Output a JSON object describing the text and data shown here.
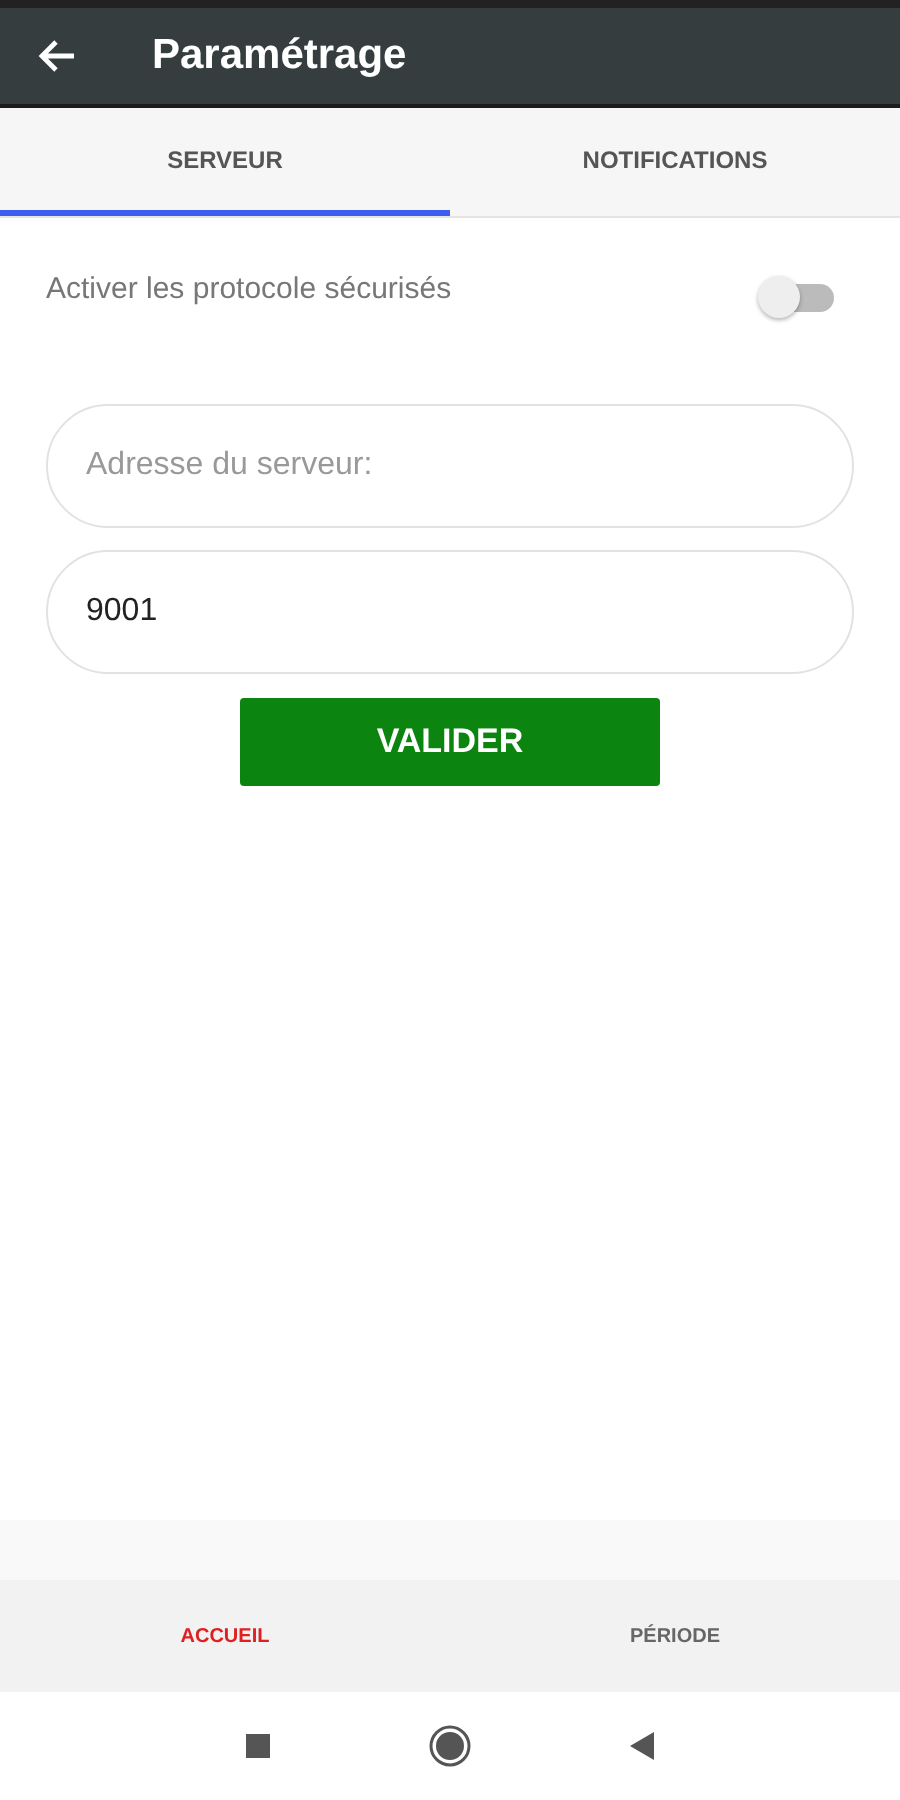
{
  "app_bar": {
    "title": "Paramétrage"
  },
  "tabs": [
    {
      "label": "SERVEUR",
      "selected": true
    },
    {
      "label": "NOTIFICATIONS",
      "selected": false
    }
  ],
  "secure_toggle": {
    "label": "Activer les protocole sécurisés",
    "on": false
  },
  "fields": [
    {
      "placeholder": "Adresse du serveur:"
    },
    {
      "value": "9001"
    }
  ],
  "submit_button": "VALIDER",
  "bottom_nav": [
    {
      "label": "ACCUEIL",
      "selected": true
    },
    {
      "label": "PÉRIODE",
      "selected": false
    }
  ]
}
